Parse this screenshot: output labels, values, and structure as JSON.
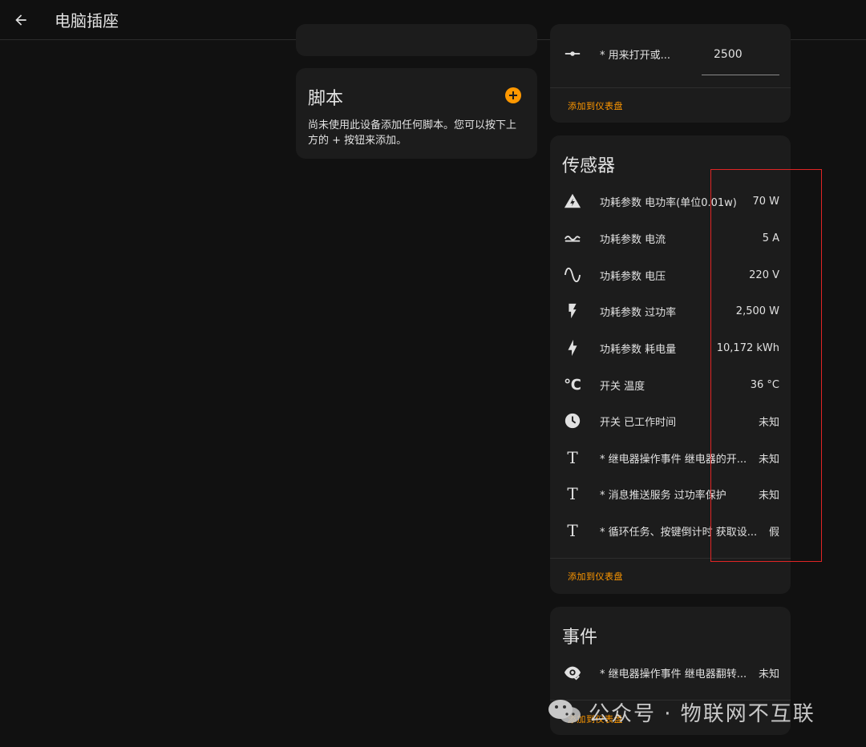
{
  "header": {
    "title": "电脑插座"
  },
  "scripts_card": {
    "title": "脚本",
    "description_line1": "尚未使用此设备添加任何脚本。您可以按下上",
    "description_line2": "方的 + 按钮来添加。"
  },
  "config_card": {
    "rows": [
      {
        "icon": "slider-icon",
        "name": "* 用来打开或...",
        "value": "2500"
      }
    ],
    "add_label": "添加到仪表盘"
  },
  "sensors_card": {
    "title": "传感器",
    "rows": [
      {
        "icon": "power-alert-icon",
        "name": "功耗参数 电功率(单位0.01w)",
        "value": "70 W"
      },
      {
        "icon": "current-ac-icon",
        "name": "功耗参数 电流",
        "value": "5 A"
      },
      {
        "icon": "sine-wave-icon",
        "name": "功耗参数 电压",
        "value": "220 V"
      },
      {
        "icon": "flash-icon",
        "name": "功耗参数 过功率",
        "value": "2,500 W"
      },
      {
        "icon": "lightning-bolt-icon",
        "name": "功耗参数 耗电量",
        "value": "10,172 kWh"
      },
      {
        "icon": "temperature-celsius-icon",
        "name": "开关 温度",
        "value": "36 °C"
      },
      {
        "icon": "clock-icon",
        "name": "开关 已工作时间",
        "value": "未知"
      },
      {
        "icon": "text-icon",
        "name": "* 继电器操作事件 继电器的开...",
        "value": "未知"
      },
      {
        "icon": "text-icon",
        "name": "* 消息推送服务 过功率保护",
        "value": "未知"
      },
      {
        "icon": "text-icon",
        "name": "* 循环任务、按键倒计时 获取设...",
        "value": "假"
      }
    ],
    "add_label": "添加到仪表盘"
  },
  "events_card": {
    "title": "事件",
    "rows": [
      {
        "icon": "eye-check-icon",
        "name": "* 继电器操作事件 继电器翻转...",
        "value": "未知"
      }
    ],
    "add_label": "添加到仪表盘"
  },
  "watermark": {
    "text": "公众号 · 物联网不互联"
  },
  "colors": {
    "accent": "#ff9800",
    "card": "#1c1c1c",
    "background": "#111111",
    "highlight": "#e02525"
  }
}
